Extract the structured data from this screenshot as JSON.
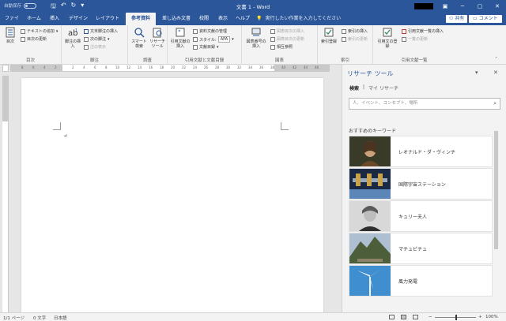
{
  "titlebar": {
    "autosave_label": "自動保存",
    "autosave_state": "オフ",
    "doc_title": "文書 1  -  Word",
    "minimize": "─",
    "restore": "▢",
    "close": "✕"
  },
  "tabs": [
    "ファイル",
    "ホーム",
    "挿入",
    "デザイン",
    "レイアウト",
    "参考資料",
    "差し込み文書",
    "校閲",
    "表示",
    "ヘルプ"
  ],
  "active_tab": "参考資料",
  "tellme": "実行したい作業を入力してください",
  "share_label": "共有",
  "comment_label": "コメント",
  "ribbon": {
    "toc": {
      "label": "目次",
      "add_text": "テキストの追加",
      "update_toc": "目次の更新",
      "group": "目次"
    },
    "footnotes": {
      "insert_footnote": "脚注の挿入",
      "insert_endnote": "文末脚注の挿入",
      "next_footnote": "次の脚注",
      "show_notes": "注の表示",
      "group": "脚注"
    },
    "research": {
      "smart_lookup": "スマート検索",
      "researcher": "リサーチツール",
      "group": "調査"
    },
    "citations": {
      "insert_citation": "引用文献の挿入",
      "manage_sources": "資料文献の管理",
      "style_label": "スタイル:",
      "style_value": "APA",
      "bibliography": "文献目録",
      "group": "引用文献と文献目録"
    },
    "captions": {
      "insert_caption": "図表番号の挿入",
      "insert_tof": "図表目次の挿入",
      "update_table": "図表目次の更新",
      "cross_reference": "相互参照",
      "group": "図表"
    },
    "index": {
      "mark_entry": "索引登録",
      "insert_index": "索引の挿入",
      "update_index": "索引の更新",
      "group": "索引"
    },
    "toa": {
      "mark_citation": "引用文の登録",
      "insert_toa": "引用文献一覧の挿入",
      "update_table": "一覧の更新",
      "group": "引用文献一覧"
    }
  },
  "ruler_numbers": [
    "8",
    "6",
    "4",
    "2",
    "2",
    "4",
    "6",
    "8",
    "10",
    "12",
    "14",
    "16",
    "18",
    "20",
    "22",
    "24",
    "26",
    "28",
    "30",
    "32",
    "34",
    "36",
    "38",
    "40",
    "42",
    "44",
    "46",
    "48"
  ],
  "pane": {
    "title": "リサーチ ツール",
    "tab_search": "検索",
    "tab_separator": "|",
    "tab_my_research": "マイ リサーチ",
    "search_placeholder": "人、イベント、コンセプト、場所",
    "keywords_header": "おすすめのキーワード",
    "keywords": [
      {
        "label": "レオナルド・ダ・ヴィンチ",
        "thumb": "portrait"
      },
      {
        "label": "国際宇宙ステーション",
        "thumb": "station"
      },
      {
        "label": "キュリー夫人",
        "thumb": "curie"
      },
      {
        "label": "マチュピチュ",
        "thumb": "mountain"
      },
      {
        "label": "風力発電",
        "thumb": "wind"
      }
    ]
  },
  "status": {
    "page": "1/1 ページ",
    "words": "0 文字",
    "language": "日本語",
    "zoom": "100%"
  },
  "colors": {
    "brand": "#2b579a",
    "ribbon_bg": "#f3f3f3"
  }
}
